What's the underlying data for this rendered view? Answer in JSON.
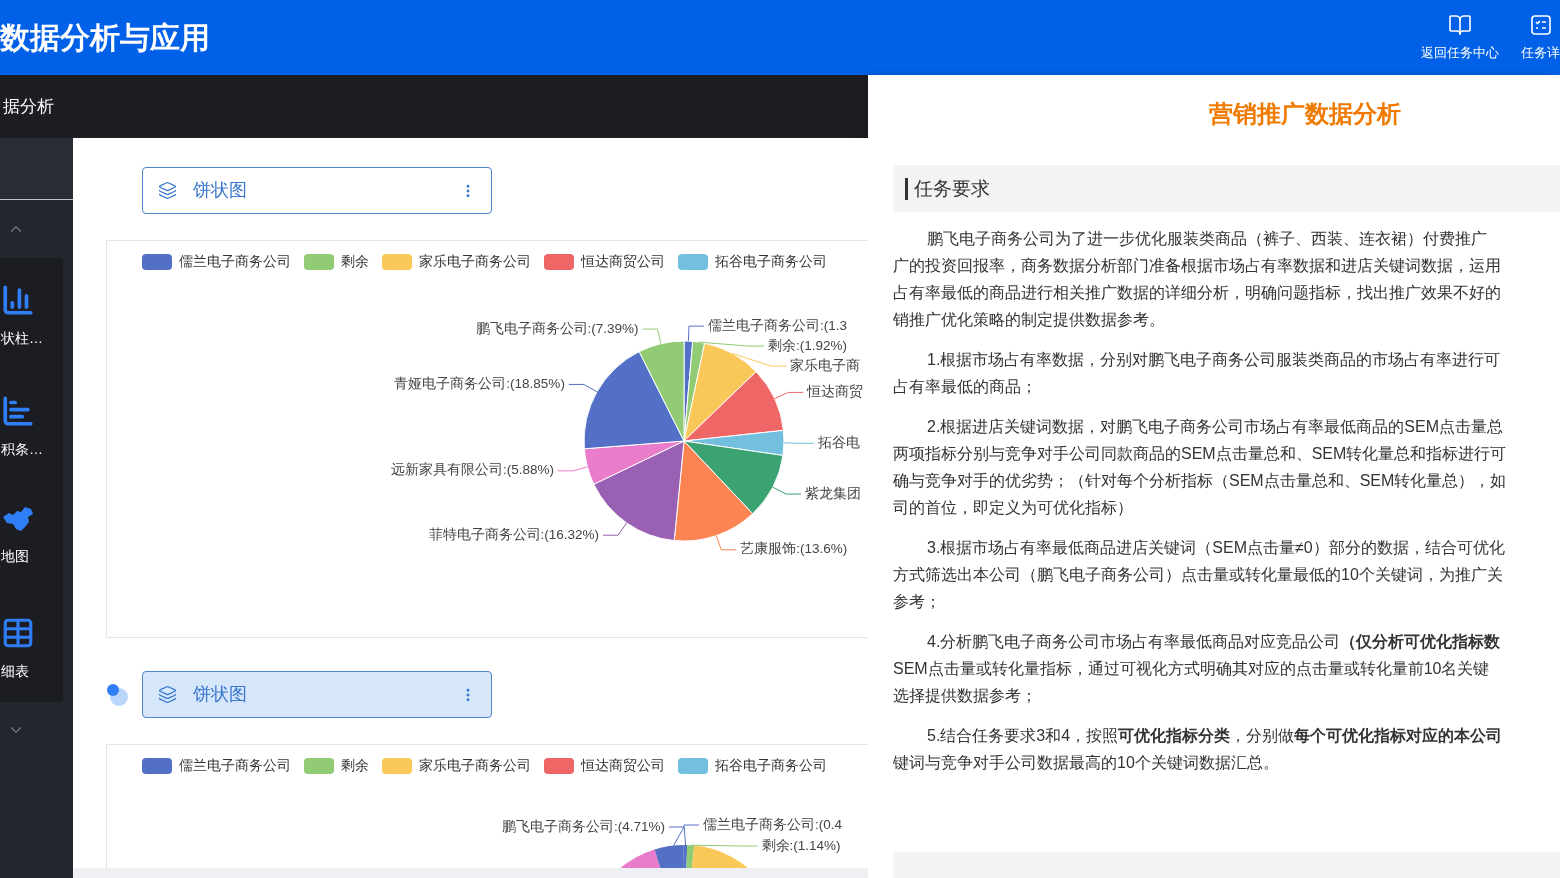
{
  "header": {
    "title": "数据分析与应用",
    "actions": [
      {
        "label": "返回任务中心"
      },
      {
        "label": "任务详"
      }
    ]
  },
  "subheader": {
    "title": "据分析"
  },
  "sidebar": {
    "items": [
      {
        "label": "状柱…"
      },
      {
        "label": "积条…"
      },
      {
        "label": "地图"
      },
      {
        "label": "细表"
      }
    ]
  },
  "charts": [
    {
      "selector": {
        "label": "饼状图",
        "selected": false,
        "loading": false
      },
      "legend": [
        {
          "name": "儒兰电子商务公司",
          "color": "#5470c6"
        },
        {
          "name": "剩余",
          "color": "#91cc75"
        },
        {
          "name": "家乐电子商务公司",
          "color": "#fac858"
        },
        {
          "name": "恒达商贸公司",
          "color": "#ee6666"
        },
        {
          "name": "拓谷电子商务公司",
          "color": "#73c0de"
        }
      ],
      "slices": [
        {
          "color": "#5470c6"
        },
        {
          "color": "#91cc75"
        },
        {
          "color": "#fac858"
        },
        {
          "color": "#ee6666"
        },
        {
          "color": "#73c0de"
        },
        {
          "color": "#3ba272"
        },
        {
          "color": "#fc8452"
        },
        {
          "color": "#9a60b4"
        },
        {
          "color": "#ea7ccc"
        },
        {
          "color": "#5470c6"
        },
        {
          "color": "#91cc75"
        }
      ],
      "chart_data": {
        "type": "pie",
        "categories": [
          "儒兰电子商务公司:(1.3",
          "剩余:(1.92%)",
          "家乐电子商",
          "恒达商贸",
          "拓谷电",
          "紫龙集团",
          "艺康服饰:(13.6%)",
          "菲特电子商务公司:(16.32%)",
          "远新家具有限公司:(5.88%)",
          "青娅电子商务公司:(18.85%)",
          "鹏飞电子商务公司:(7.39%)"
        ],
        "values": [
          1.39,
          1.92,
          9.5,
          10.5,
          4,
          10.65,
          13.6,
          16.32,
          5.88,
          18.85,
          7.39
        ]
      }
    },
    {
      "selector": {
        "label": "饼状图",
        "selected": true,
        "loading": true
      },
      "legend": [
        {
          "name": "儒兰电子商务公司",
          "color": "#5470c6"
        },
        {
          "name": "剩余",
          "color": "#91cc75"
        },
        {
          "name": "家乐电子商务公司",
          "color": "#fac858"
        },
        {
          "name": "恒达商贸公司",
          "color": "#ee6666"
        },
        {
          "name": "拓谷电子商务公司",
          "color": "#73c0de"
        }
      ],
      "labels": [
        {
          "text": "鹏飞电子商务公司:(4.71%)"
        },
        {
          "text": "儒兰电子商务公司:(0.4"
        },
        {
          "text": "剩余:(1.14%)"
        }
      ]
    }
  ],
  "task_panel": {
    "title": "营销推广数据分析",
    "section": {
      "heading": "任务要求",
      "paragraphs": [
        [
          "鹏飞电子商务公司为了进一步优化服装类商品（裤子、西装、连衣裙）付费推广",
          "广的投资回报率，商务数据分析部门准备根据市场占有率数据和进店关键词数据，运用",
          "占有率最低的商品进行相关推广数据的详细分析，明确问题指标，找出推广效果不好的",
          "销推广优化策略的制定提供数据参考。"
        ],
        [
          "1.根据市场占有率数据，分别对鹏飞电子商务公司服装类商品的市场占有率进行可",
          "占有率最低的商品；"
        ],
        [
          "2.根据进店关键词数据，对鹏飞电子商务公司市场占有率最低商品的SEM点击量总",
          "两项指标分别与竞争对手公司同款商品的SEM点击量总和、SEM转化量总和指标进行可",
          "确与竞争对手的优劣势；（针对每个分析指标（SEM点击量总和、SEM转化量总），如",
          "司的首位，即定义为可优化指标）"
        ],
        [
          "3.根据市场占有率最低商品进店关键词（SEM点击量≠0）部分的数据，结合可优化",
          "方式筛选出本公司（鹏飞电子商务公司）点击量或转化量最低的10个关键词，为推广关",
          "参考；"
        ],
        [
          "4.分析鹏飞电子商务公司市场占有率最低商品对应竞品公司**（仅分析可优化指标数**",
          "SEM点击量或转化量指标，通过可视化方式明确其对应的点击量或转化量前10名关键",
          "选择提供数据参考；"
        ],
        [
          "5.结合任务要求3和4，按照**可优化指标分类**，分别做**每个可优化指标对应的本公司**",
          "键词与竞争对手公司数据最高的10个关键词数据汇总。"
        ]
      ]
    }
  }
}
